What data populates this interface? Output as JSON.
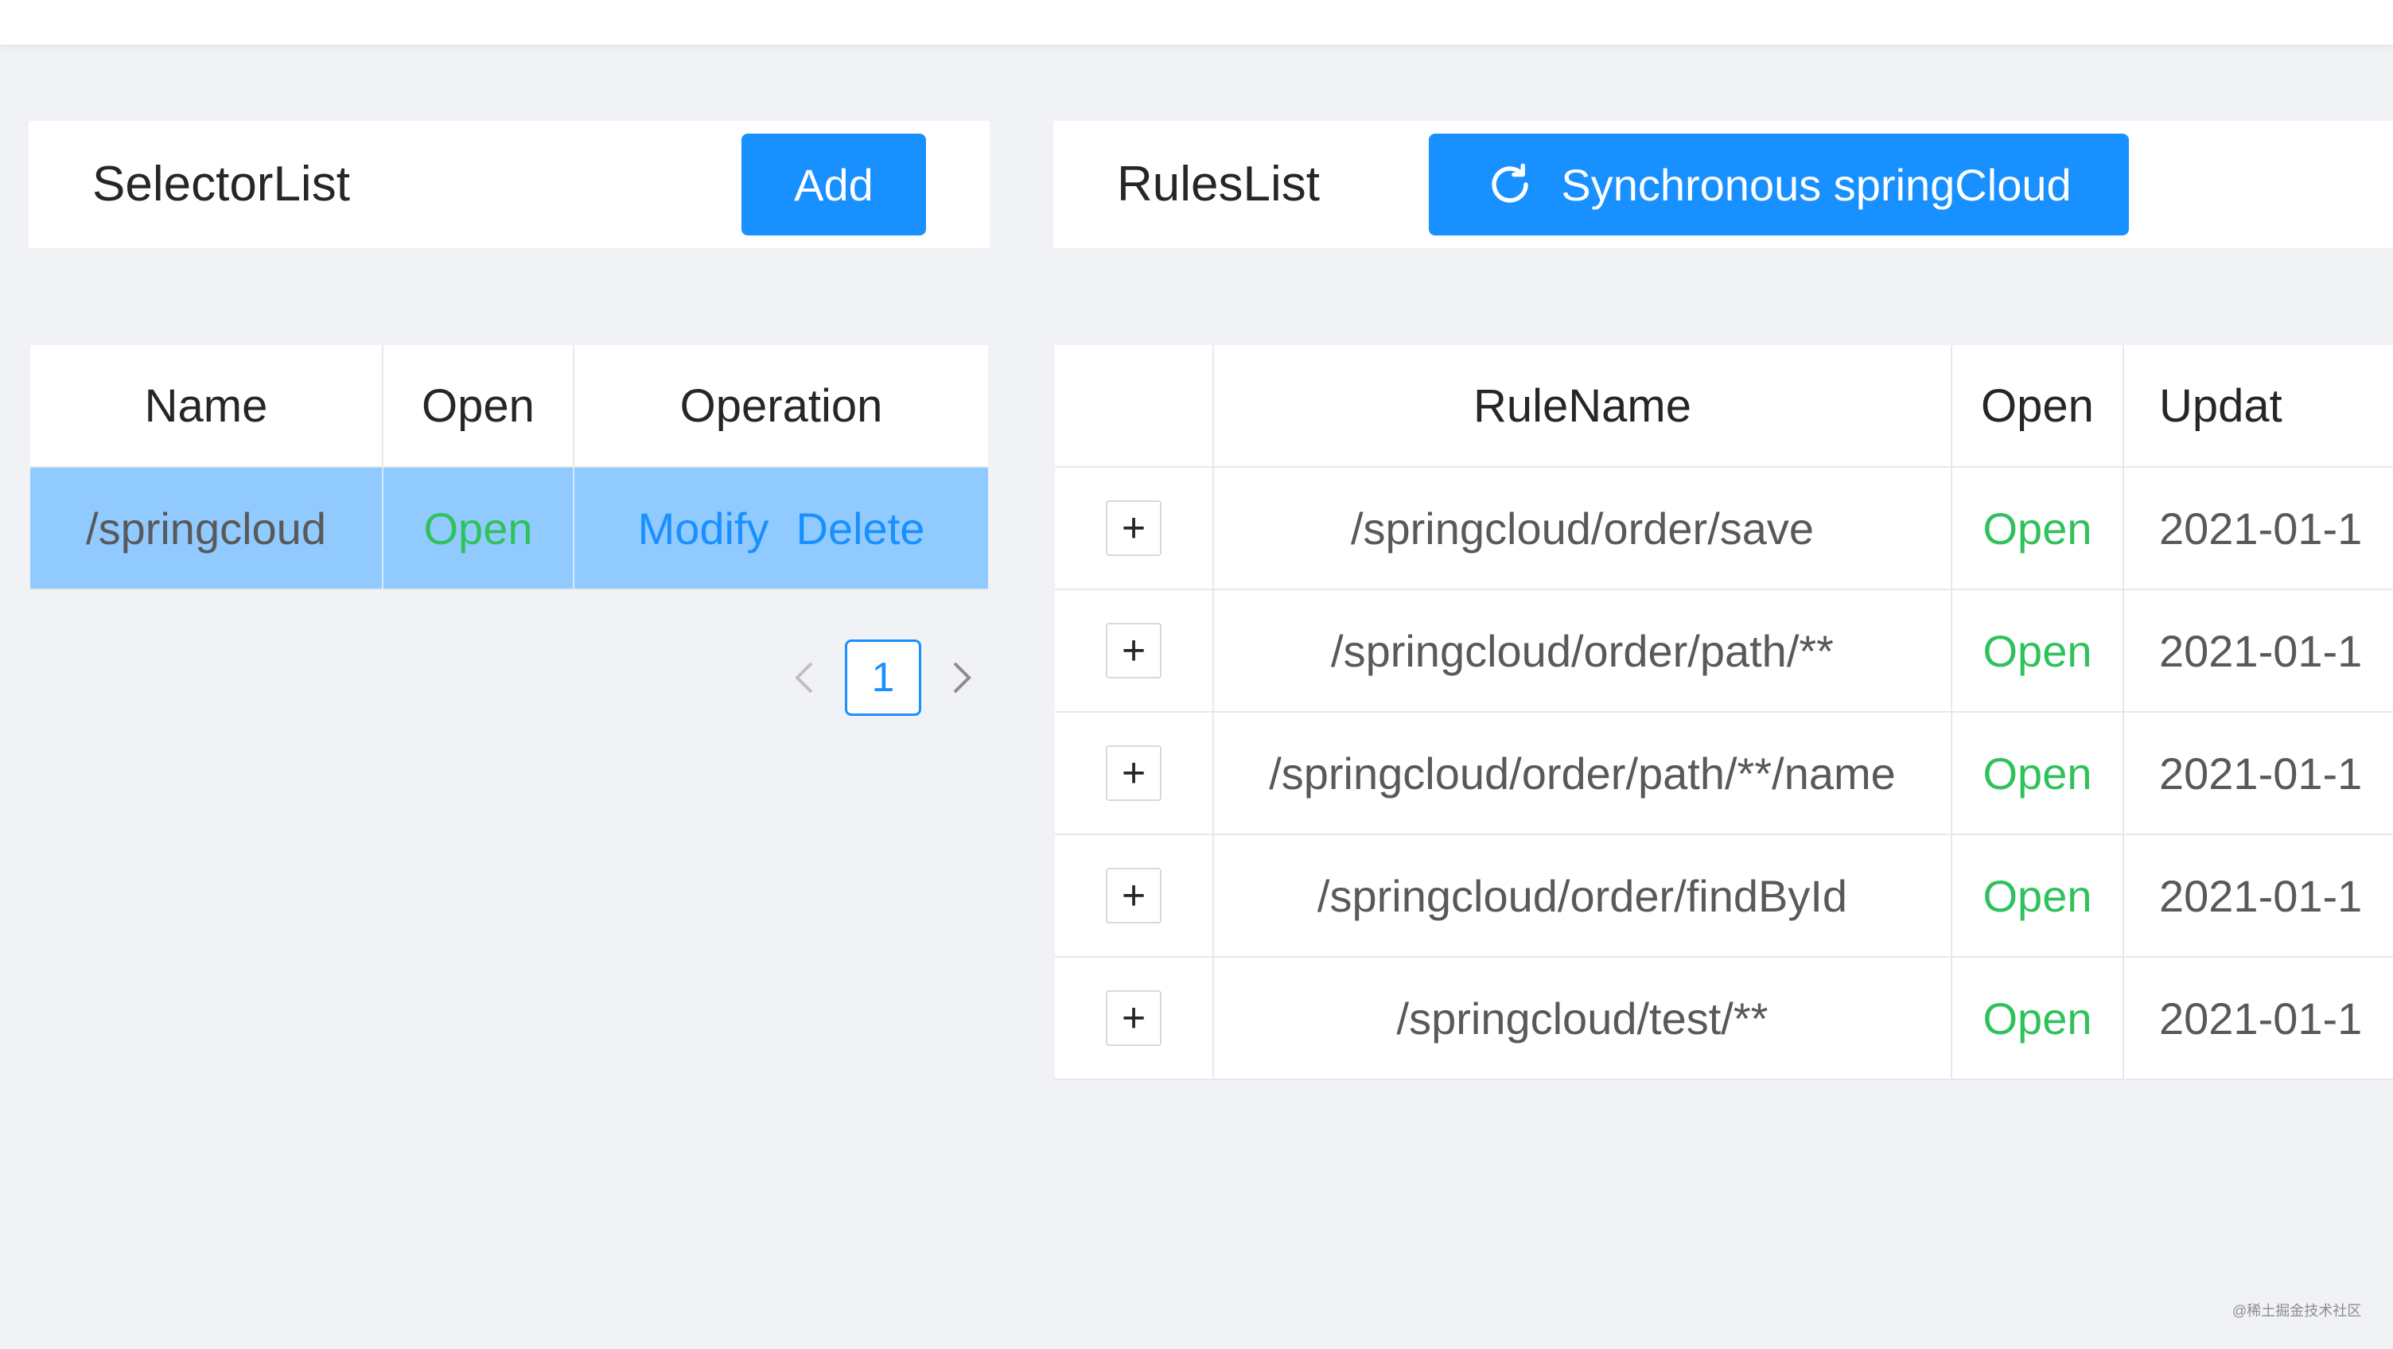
{
  "selector_panel": {
    "title": "SelectorList",
    "add_label": "Add",
    "columns": [
      "Name",
      "Open",
      "Operation"
    ],
    "rows": [
      {
        "name": "/springcloud",
        "open": "Open",
        "modify": "Modify",
        "delete": "Delete"
      }
    ],
    "pagination": {
      "current_page": "1"
    }
  },
  "rules_panel": {
    "title": "RulesList",
    "sync_label": "Synchronous springCloud",
    "columns": [
      "",
      "RuleName",
      "Open",
      "Updat"
    ],
    "rows": [
      {
        "expand": "+",
        "rule_name": "/springcloud/order/save",
        "open": "Open",
        "updated": "2021-01-1"
      },
      {
        "expand": "+",
        "rule_name": "/springcloud/order/path/**",
        "open": "Open",
        "updated": "2021-01-1"
      },
      {
        "expand": "+",
        "rule_name": "/springcloud/order/path/**/name",
        "open": "Open",
        "updated": "2021-01-1"
      },
      {
        "expand": "+",
        "rule_name": "/springcloud/order/findById",
        "open": "Open",
        "updated": "2021-01-1"
      },
      {
        "expand": "+",
        "rule_name": "/springcloud/test/**",
        "open": "Open",
        "updated": "2021-01-1"
      }
    ]
  },
  "watermark": "@稀土掘金技术社区",
  "colors": {
    "primary": "#1890ff",
    "open_green": "#2fc25b",
    "selected_row": "#91caff",
    "background": "#f0f2f5"
  },
  "icons": {
    "sync": "reload-icon",
    "prev": "chevron-left-icon",
    "next": "chevron-right-icon"
  }
}
